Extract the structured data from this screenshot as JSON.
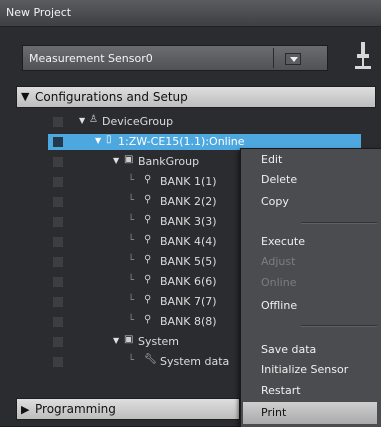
{
  "window": {
    "title": "New Project"
  },
  "device_selector": {
    "value": "Measurement Sensor0"
  },
  "sections": {
    "configurations": "Configurations and Setup",
    "programming": "Programming"
  },
  "tree": {
    "device_group": "DeviceGroup",
    "device": "1:ZW-CE15(1.1):Online",
    "bank_group": "BankGroup",
    "banks": [
      "BANK 1(1)",
      "BANK 2(2)",
      "BANK 3(3)",
      "BANK 4(4)",
      "BANK 5(5)",
      "BANK 6(6)",
      "BANK 7(7)",
      "BANK 8(8)"
    ],
    "system": "System",
    "system_data": "System data"
  },
  "context_menu": {
    "items": [
      {
        "label": "Edit",
        "enabled": true
      },
      {
        "label": "Delete",
        "enabled": true
      },
      {
        "label": "Copy",
        "enabled": true
      },
      {
        "label": "Execute",
        "enabled": true
      },
      {
        "label": "Adjust",
        "enabled": false
      },
      {
        "label": "Online",
        "enabled": false
      },
      {
        "label": "Offline",
        "enabled": true
      },
      {
        "label": "Save data",
        "enabled": true
      },
      {
        "label": "Initialize Sensor",
        "enabled": true
      },
      {
        "label": "Restart",
        "enabled": true
      },
      {
        "label": "Print",
        "enabled": true,
        "highlighted": true
      }
    ]
  },
  "colors": {
    "selection": "#4ea8e0",
    "background": "#2b2c2f"
  }
}
